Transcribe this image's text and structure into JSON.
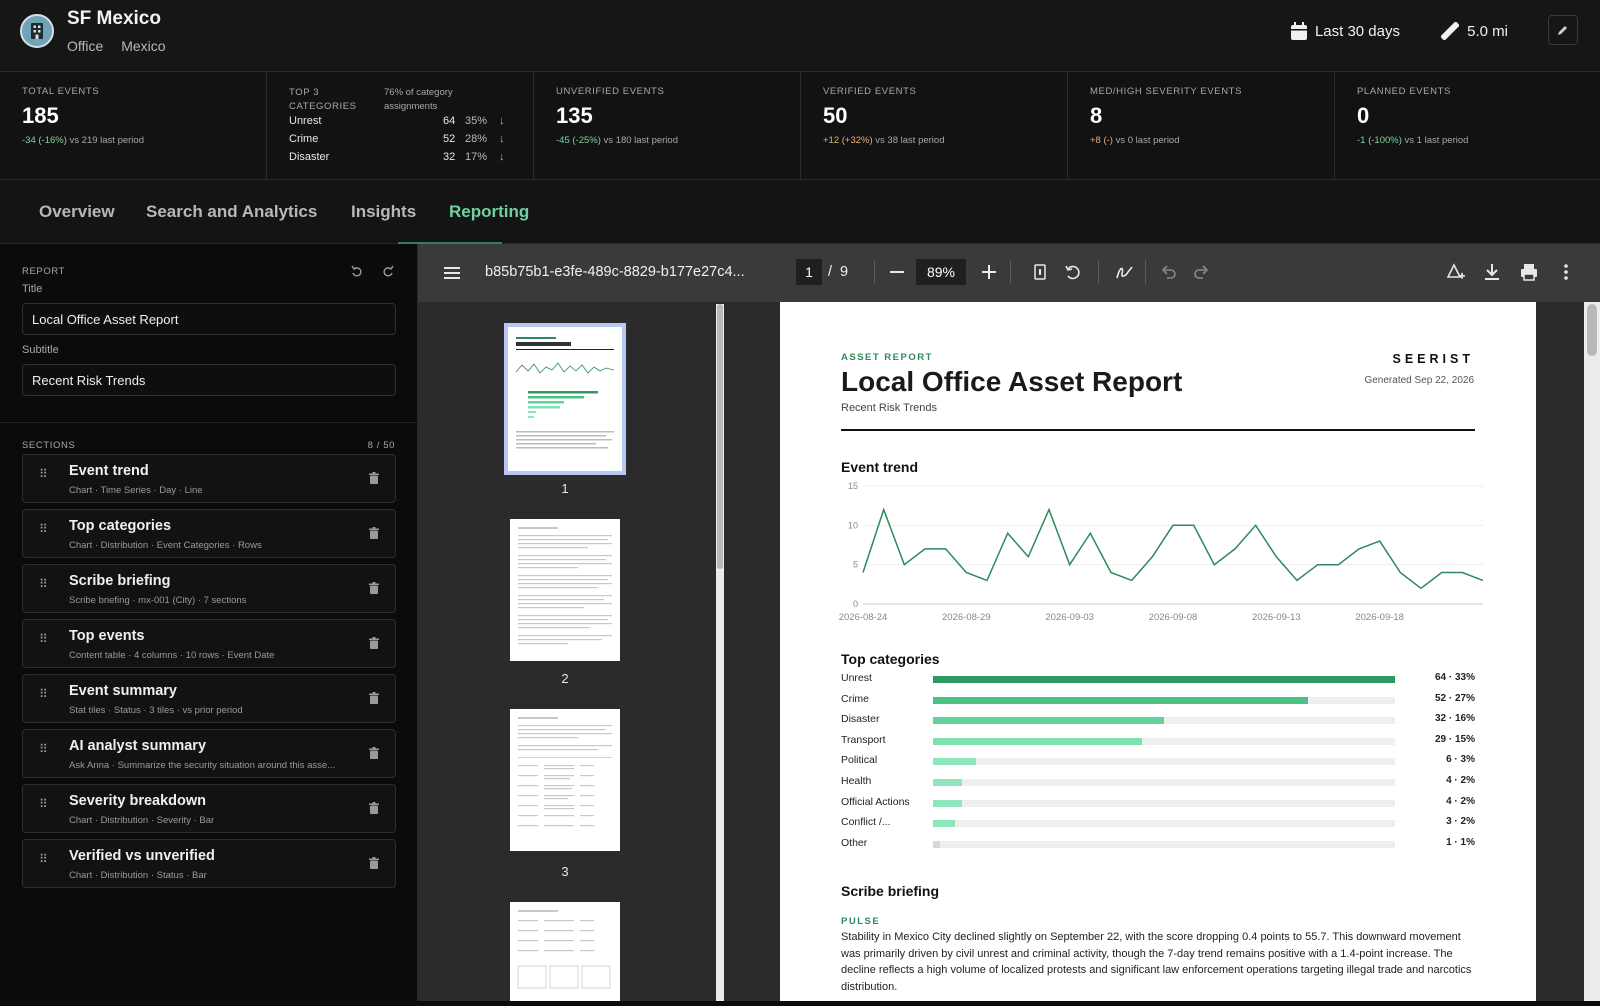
{
  "header": {
    "site_name": "SF Mexico",
    "site_type": "Office",
    "site_country": "Mexico",
    "date_range": "Last 30 days",
    "distance": "5.0 mi",
    "icons": {
      "logo": "building-icon",
      "range": "calendar-icon",
      "distance": "ruler-icon",
      "edit": "pencil-icon"
    }
  },
  "stats": {
    "total": {
      "label": "TOTAL EVENTS",
      "value": "185",
      "delta": "-34 (-16%)",
      "compare": "vs 219 last period"
    },
    "top3": {
      "label": "TOP 3 CATEGORIES",
      "note": "76% of category assignments",
      "rows": [
        {
          "name": "Unrest",
          "count": "64",
          "pct": "35%"
        },
        {
          "name": "Crime",
          "count": "52",
          "pct": "28%"
        },
        {
          "name": "Disaster",
          "count": "32",
          "pct": "17%"
        }
      ]
    },
    "unverified": {
      "label": "UNVERIFIED EVENTS",
      "value": "135",
      "delta": "-45 (-25%)",
      "compare": "vs 180 last period"
    },
    "verified": {
      "label": "VERIFIED EVENTS",
      "value": "50",
      "delta": "+12 (+32%)",
      "compare": "vs 38 last period"
    },
    "severity": {
      "label": "MED/HIGH SEVERITY EVENTS",
      "value": "8",
      "delta": "+8 (-)",
      "compare": "vs 0 last period"
    },
    "planned": {
      "label": "PLANNED EVENTS",
      "value": "0",
      "delta": "-1 (-100%)",
      "compare": "vs 1 last period"
    }
  },
  "tabs": [
    {
      "label": "Overview"
    },
    {
      "label": "Search and Analytics"
    },
    {
      "label": "Insights"
    },
    {
      "label": "Reporting",
      "active": true
    }
  ],
  "left": {
    "report_label": "REPORT",
    "title_label": "Title",
    "title_value": "Local Office Asset Report",
    "subtitle_label": "Subtitle",
    "subtitle_value": "Recent Risk Trends",
    "sections_label": "SECTIONS",
    "sections_count": "8 / 50",
    "sections": [
      {
        "title": "Event trend",
        "sub": "Chart · Time Series · Day · Line"
      },
      {
        "title": "Top categories",
        "sub": "Chart · Distribution · Event Categories · Rows"
      },
      {
        "title": "Scribe briefing",
        "sub": "Scribe briefing · mx-001 (City) · 7 sections"
      },
      {
        "title": "Top events",
        "sub": "Content table · 4 columns · 10 rows · Event Date"
      },
      {
        "title": "Event summary",
        "sub": "Stat tiles · Status · 3 tiles · vs prior period"
      },
      {
        "title": "AI analyst summary",
        "sub": "Ask Anna · Summarize the security situation around this asse..."
      },
      {
        "title": "Severity breakdown",
        "sub": "Chart · Distribution · Severity · Bar"
      },
      {
        "title": "Verified vs unverified",
        "sub": "Chart · Distribution · Status · Bar"
      }
    ]
  },
  "viewer": {
    "filename": "b85b75b1-e3fe-489c-8829-b177e27c4...",
    "page_current": "1",
    "page_sep": "/",
    "page_total": "9",
    "zoom": "89%",
    "thumb_labels": [
      "1",
      "2",
      "3"
    ]
  },
  "report": {
    "kicker": "ASSET REPORT",
    "title": "Local Office Asset Report",
    "subtitle": "Recent Risk Trends",
    "brand": "SEERIST",
    "generated": "Generated Sep 22, 2026",
    "trend_heading": "Event trend",
    "categories_heading": "Top categories",
    "scribe_heading": "Scribe briefing",
    "pulse_label": "PULSE",
    "scribe_text": "Stability in Mexico City declined slightly on September 22, with the score dropping 0.4 points to 55.7. This downward movement was primarily driven by civil unrest and criminal activity, though the 7-day trend remains positive with a 1.4-point increase. The decline reflects a high volume of localized protests and significant law enforcement operations targeting illegal trade and narcotics distribution."
  },
  "chart_data": [
    {
      "type": "line",
      "title": "Event trend",
      "x_ticks": [
        "2026-08-24",
        "2026-08-29",
        "2026-09-03",
        "2026-09-08",
        "2026-09-13",
        "2026-09-18"
      ],
      "y_ticks": [
        "15",
        "10",
        "5",
        "0"
      ],
      "ylim": [
        0,
        15
      ],
      "series": [
        {
          "values": [
            4,
            12,
            5,
            7,
            7,
            4,
            3,
            9,
            6,
            12,
            5,
            9,
            4,
            3,
            6,
            10,
            10,
            5,
            7,
            10,
            6,
            3,
            5,
            5,
            7,
            8,
            4,
            2,
            4,
            4,
            3
          ]
        }
      ],
      "color": "#2e8a5a"
    },
    {
      "type": "bar",
      "title": "Top categories",
      "categories": [
        "Unrest",
        "Crime",
        "Disaster",
        "Transport",
        "Political",
        "Health",
        "Official Actions",
        "Conflict /...",
        "Other"
      ],
      "values": [
        64,
        52,
        32,
        29,
        6,
        4,
        4,
        3,
        1
      ],
      "labels": [
        "64 · 33%",
        "52 · 27%",
        "32 · 16%",
        "29 · 15%",
        "6 · 3%",
        "4 · 2%",
        "4 · 2%",
        "3 · 2%",
        "1 · 1%"
      ],
      "colors": [
        "#2e9a62",
        "#4cbf82",
        "#5fd39a",
        "#7fe0b0",
        "#8fe6bc",
        "#8fe6bc",
        "#8fe6bc",
        "#8fe6bc",
        "#d8d8d8"
      ],
      "xlim": [
        0,
        64
      ]
    }
  ]
}
